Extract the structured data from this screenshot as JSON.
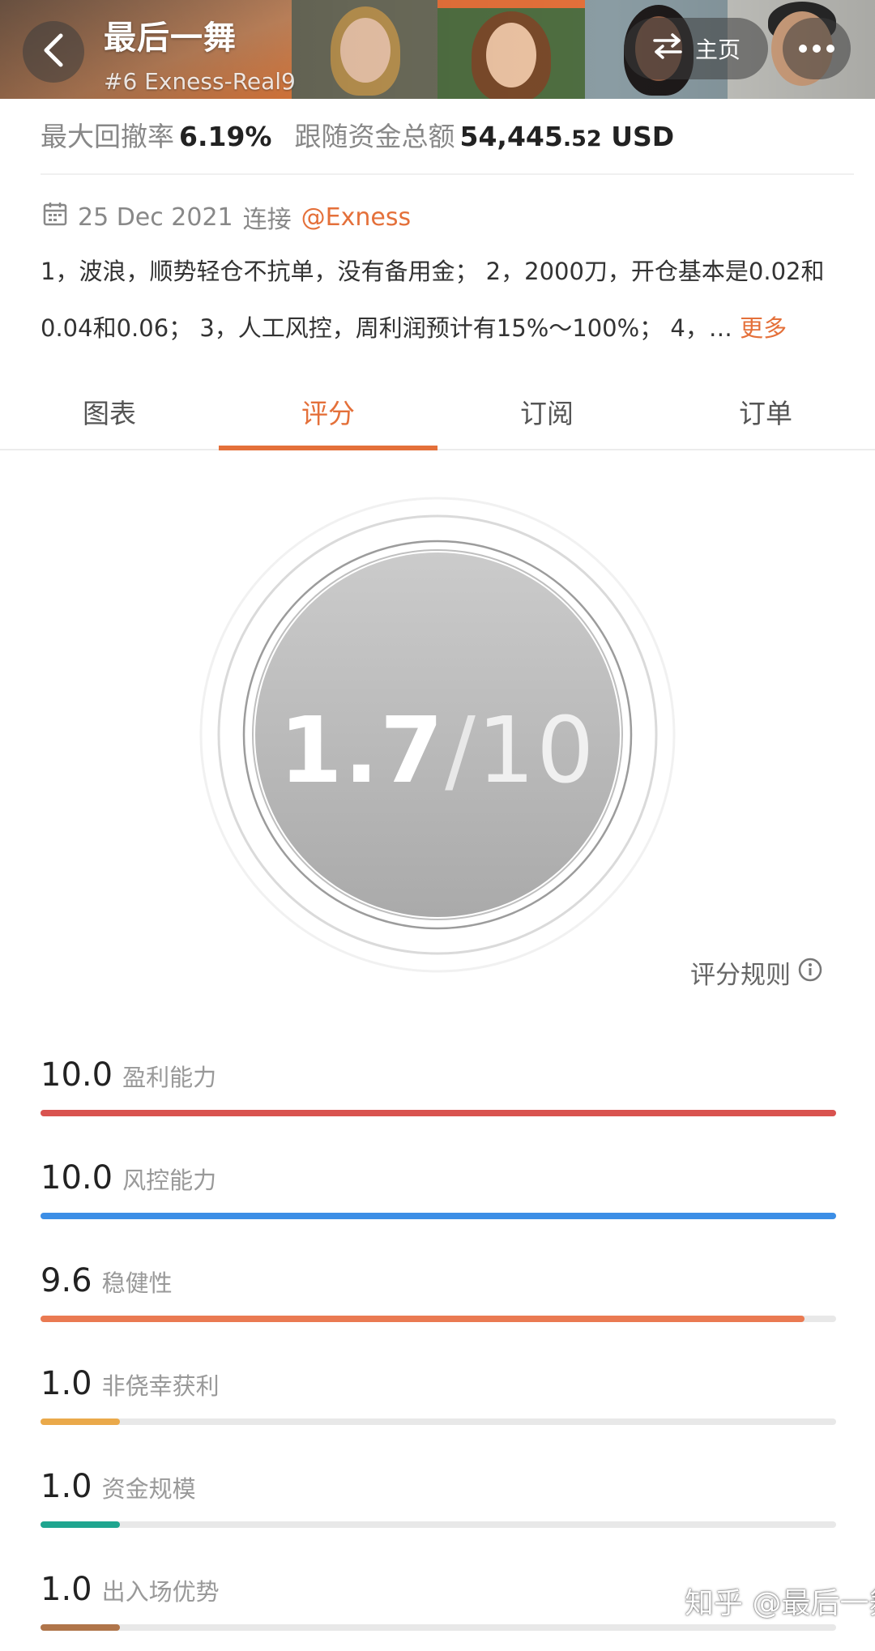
{
  "header": {
    "title": "最后一舞",
    "subtitle": "#6  Exness-Real9",
    "home_label": "主页"
  },
  "stats": {
    "drawdown_label": "最大回撤率",
    "drawdown_value": "6.19%",
    "funds_label": "跟随资金总额",
    "funds_value_int": "54,445",
    "funds_value_dec": ".52",
    "funds_currency": "USD"
  },
  "meta": {
    "date": "25 Dec 2021",
    "connect_label": "连接",
    "broker": "@Exness"
  },
  "description": {
    "line1": "1，波浪，顺势轻仓不抗单，没有备用金； 2，2000刀，开仓基本是0.02和",
    "line2": "0.04和0.06； 3，人工风控，周利润预计有15%～100%； 4，… ",
    "more": "更多"
  },
  "tabs": [
    {
      "label": "图表",
      "active": false
    },
    {
      "label": "评分",
      "active": true
    },
    {
      "label": "订阅",
      "active": false
    },
    {
      "label": "订单",
      "active": false
    }
  ],
  "score": {
    "value": "1.7",
    "slash": "/",
    "max": "10"
  },
  "rules_label": "评分规则",
  "metrics": [
    {
      "value": "10.0",
      "label": "盈利能力",
      "fraction": 1.0,
      "color": "#d9534f"
    },
    {
      "value": "10.0",
      "label": "风控能力",
      "fraction": 1.0,
      "color": "#3c8ee6"
    },
    {
      "value": "9.6",
      "label": "稳健性",
      "fraction": 0.96,
      "color": "#ea7a52"
    },
    {
      "value": "1.0",
      "label": "非侥幸获利",
      "fraction": 0.1,
      "color": "#eaa94a"
    },
    {
      "value": "1.0",
      "label": "资金规模",
      "fraction": 0.1,
      "color": "#1fa58f"
    },
    {
      "value": "1.0",
      "label": "出入场优势",
      "fraction": 0.1,
      "color": "#b0754a"
    }
  ],
  "colors": {
    "accent": "#e4703a"
  },
  "watermark": "知乎 @最后一舞"
}
